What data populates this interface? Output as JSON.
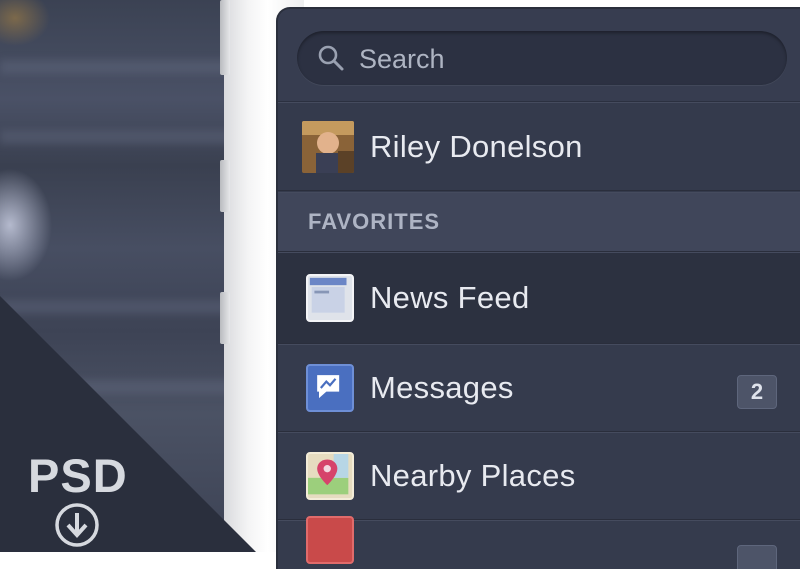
{
  "search": {
    "placeholder": "Search"
  },
  "profile": {
    "name": "Riley Donelson"
  },
  "sections": {
    "favorites": "FAVORITES"
  },
  "menu": [
    {
      "label": "News Feed",
      "icon": "news-feed-icon"
    },
    {
      "label": "Messages",
      "icon": "messages-icon",
      "badge": "2"
    },
    {
      "label": "Nearby Places",
      "icon": "nearby-places-icon"
    }
  ],
  "overlay": {
    "psd_label": "PSD",
    "icon": "download-icon"
  },
  "colors": {
    "sidebar_bg": "#353b4d",
    "selected_row_bg": "#2c3140",
    "section_header_bg": "#40465a",
    "messenger_blue": "#4a6fc0",
    "text_primary": "#e8eaf0"
  }
}
